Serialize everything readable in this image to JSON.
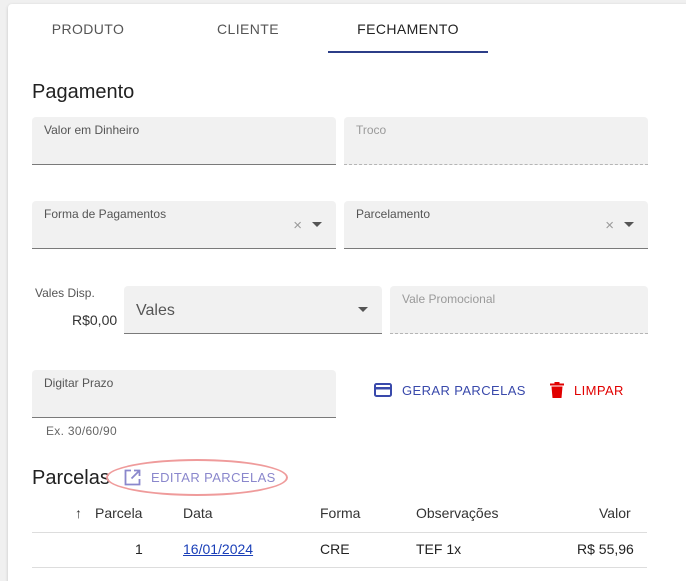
{
  "tabs": [
    {
      "label": "PRODUTO"
    },
    {
      "label": "CLIENTE"
    },
    {
      "label": "FECHAMENTO"
    }
  ],
  "pagamento": {
    "title": "Pagamento",
    "valor_dinheiro_label": "Valor em Dinheiro",
    "troco_label": "Troco",
    "forma_pagamentos_label": "Forma de Pagamentos",
    "parcelamento_label": "Parcelamento",
    "clear_glyph": "×",
    "vales_disp_label": "Vales Disp.",
    "vales_disp_value": "R$0,00",
    "vales_select_value": "Vales",
    "vale_promocional_label": "Vale Promocional",
    "digitar_prazo_label": "Digitar Prazo",
    "digitar_prazo_hint": "Ex. 30/60/90",
    "gerar_parcelas_label": "GERAR PARCELAS",
    "limpar_label": "LIMPAR"
  },
  "parcelas": {
    "title": "Parcelas",
    "editar_label": "EDITAR PARCELAS",
    "columns": {
      "parcela": "Parcela",
      "data": "Data",
      "forma": "Forma",
      "observacoes": "Observações",
      "valor": "Valor"
    },
    "sort_glyph": "↑",
    "rows": [
      {
        "parcela": "1",
        "data": "16/01/2024",
        "forma": "CRE",
        "observacoes": "TEF 1x",
        "valor": "R$ 55,96"
      }
    ]
  },
  "colors": {
    "accent": "#3949ab",
    "danger": "#e10000",
    "link": "#1a3fb8",
    "tab_indicator": "#2c3e88",
    "highlight": "#ef9b9b"
  },
  "icons": {
    "gerar": "credit-card-icon",
    "limpar": "trash-icon",
    "editar": "open-in-new-icon",
    "sort": "arrow-up-icon"
  }
}
